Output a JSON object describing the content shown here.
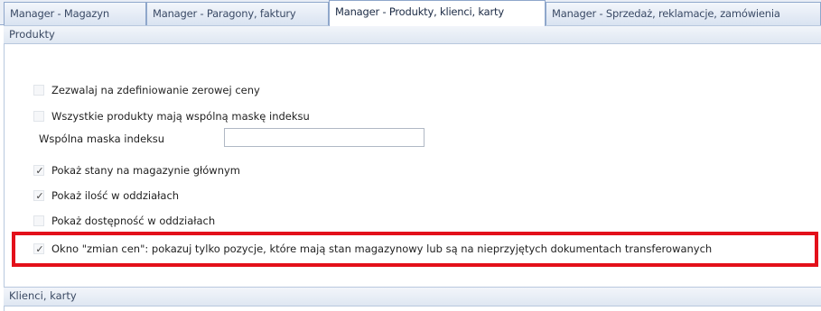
{
  "tabs": [
    {
      "label": "Manager - Magazyn",
      "active": false
    },
    {
      "label": "Manager - Paragony, faktury",
      "active": false
    },
    {
      "label": "Manager - Produkty, klienci, karty",
      "active": true
    },
    {
      "label": "Manager - Sprzedaż, reklamacje, zamówienia",
      "active": false
    }
  ],
  "sections": {
    "produkty_title": "Produkty",
    "klienci_title": "Klienci, karty"
  },
  "options": [
    {
      "label": "Zezwalaj na zdefiniowanie zerowej ceny",
      "checked": false
    },
    {
      "label": "Wszystkie produkty mają wspólną maskę indeksu",
      "checked": false
    },
    {
      "label": "Pokaż stany na magazynie głównym",
      "checked": true
    },
    {
      "label": "Pokaż ilość w oddziałach",
      "checked": true
    },
    {
      "label": "Pokaż dostępność w oddziałach",
      "checked": false
    },
    {
      "label": "Okno \"zmian cen\": pokazuj tylko pozycje, które mają stan magazynowy lub są na nieprzyjętych dokumentach transferowanych",
      "checked": true
    }
  ],
  "mask_field": {
    "label": "Wspólna maska indeksu",
    "value": ""
  },
  "colors": {
    "highlight": "#e3101a",
    "tab_border": "#8fa7cb"
  }
}
